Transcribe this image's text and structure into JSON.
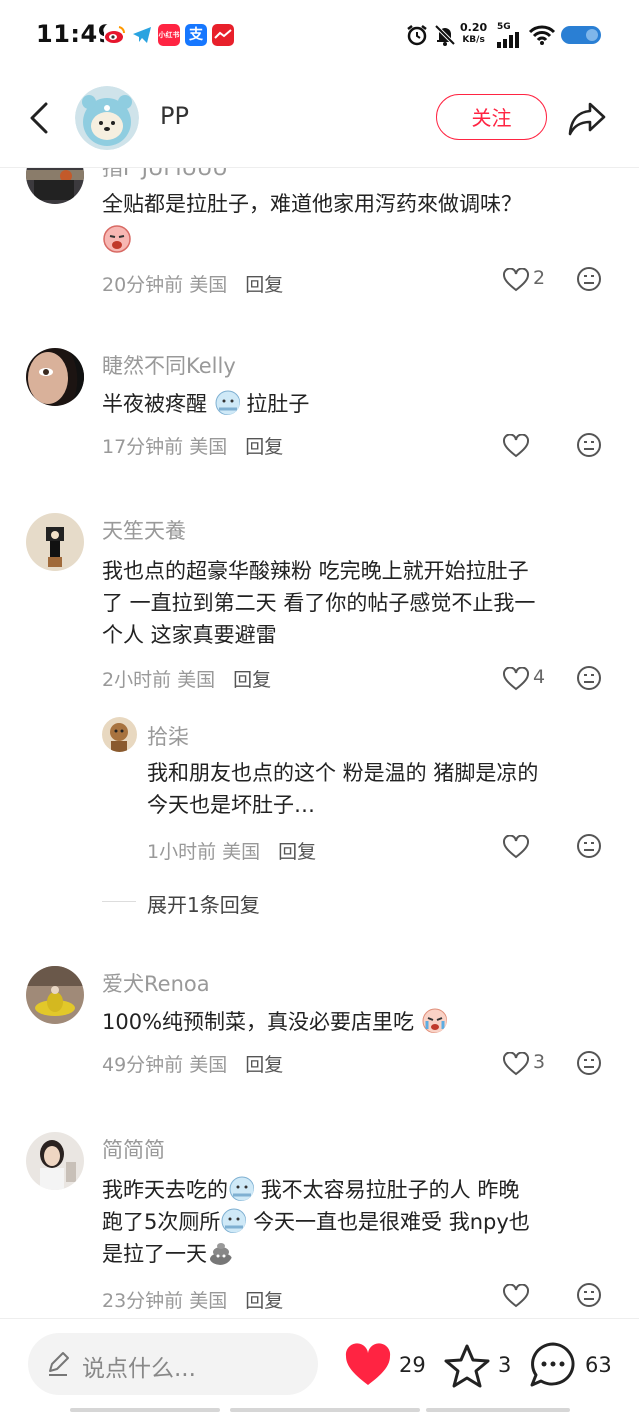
{
  "status_bar": {
    "time": "11:49",
    "net_speed_value": "0.20",
    "net_speed_unit": "KB/s",
    "signal": "5G",
    "app_icons": [
      "weibo-icon",
      "telegram-icon",
      "xiaohongshu-icon",
      "alipay-icon",
      "app-icon"
    ]
  },
  "header": {
    "author": "PP",
    "follow_label": "关注"
  },
  "comments": [
    {
      "name": "指F JUFIUUU",
      "text": "全贴都是拉肚子，难道他家用泻药來做调味？",
      "time_loc": "20分钟前 美国",
      "reply": "回复",
      "likes": "2"
    },
    {
      "name": "睫然不同Kelly",
      "text_a": "半夜被疼醒",
      "text_b": "拉肚子",
      "time_loc": "17分钟前 美国",
      "reply": "回复",
      "likes": ""
    },
    {
      "name": "天笙天養",
      "line1": "我也点的超豪华酸辣粉 吃完晚上就开始拉肚子",
      "line2": "了 一直拉到第二天 看了你的帖子感觉不止我一",
      "line3": "个人 这家真要避雷",
      "time_loc": "2小时前 美国",
      "reply": "回复",
      "likes": "4",
      "sub": {
        "name": "拾柒",
        "line1": "我和朋友也点的这个 粉是温的 猪脚是凉的",
        "line2": "今天也是坏肚子…",
        "time_loc": "1小时前 美国",
        "reply": "回复",
        "likes": ""
      },
      "expand": "展开1条回复"
    },
    {
      "name": "爱犬Renoa",
      "text": "100%纯预制菜，真没必要店里吃",
      "time_loc": "49分钟前 美国",
      "reply": "回复",
      "likes": "3"
    },
    {
      "name": "简简简",
      "l1a": "我昨天去吃的",
      "l1b": "我不太容易拉肚子的人 昨晚",
      "l2a": "跑了5次厕所",
      "l2b": "今天一直也是很难受 我npy也",
      "l3a": "是拉了一天",
      "time_loc": "23分钟前 美国",
      "reply": "回复",
      "likes": ""
    }
  ],
  "bottom_bar": {
    "placeholder": "说点什么...",
    "likes": "29",
    "stars": "3",
    "comments": "63"
  },
  "colors": {
    "accent": "#ff2442",
    "muted": "#999999"
  }
}
